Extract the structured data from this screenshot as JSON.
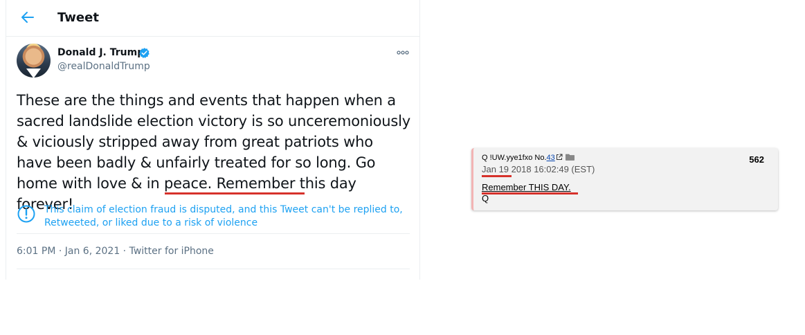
{
  "tweet": {
    "header_title": "Tweet",
    "author_name": "Donald J. Trump",
    "author_handle": "@realDonaldTrump",
    "text_before": "These are the things and events that happen when a sacred landslide election victory is so unceremoniously & viciously stripped away from great patriots who have been badly & unfairly treated for so long. Go home with love & in peace. ",
    "text_highlight": "Remember this day",
    "text_after": " forever!",
    "notice": "This claim of election fraud is disputed, and this Tweet can't be replied to, Retweeted, or liked due to a risk of violence",
    "timestamp": "6:01 PM · Jan 6, 2021 · Twitter for iPhone",
    "icons": {
      "back": "arrow-left-icon",
      "verified": "verified-badge-icon",
      "more": "more-options-icon",
      "notice": "exclamation-circle-icon"
    },
    "colors": {
      "accent": "#1da1f2",
      "highlight": "#d6312b"
    }
  },
  "qpost": {
    "author_prefix": "Q !UW.yye1fxo No.",
    "post_link": "43",
    "number": "562",
    "date_highlight": "Jan 19",
    "date_rest": " 2018 16:02:49 (EST)",
    "message": "Remember THIS DAY.",
    "signature": "Q",
    "icons": {
      "external": "external-link-icon",
      "folder": "folder-icon"
    }
  }
}
